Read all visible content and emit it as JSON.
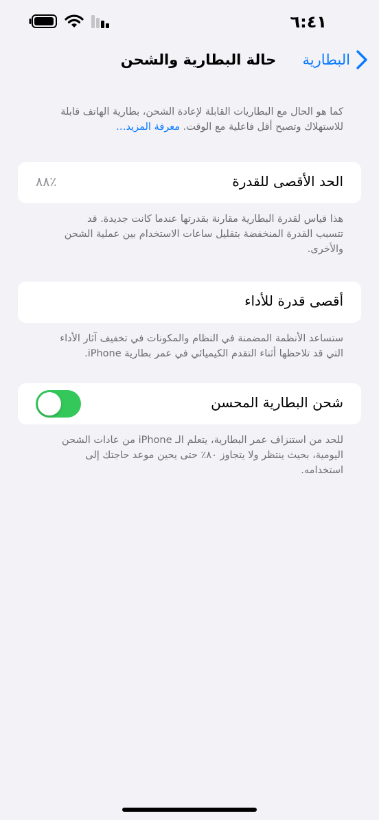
{
  "status_bar": {
    "time": "٦:٤١",
    "icons": [
      "battery-icon",
      "wifi-icon",
      "cellular-signal-icon"
    ]
  },
  "nav": {
    "back_label": "البطارية",
    "title": "حالة البطارية والشحن"
  },
  "intro": {
    "line1": "كما هو الحال مع البطاريات القابلة لإعادة الشحن، بطارية الهاتف قابلة",
    "line2": "للاستهلاك وتصبح أقل فاعلية مع الوقت.",
    "link": "معرفة المزيد…"
  },
  "max_capacity": {
    "label": "الحد الأقصى للقدرة",
    "value": "٪٨٨",
    "percent": 88,
    "desc_line1": "هذا قياس لقدرة البطارية مقارنة بقدرتها عندما كانت جديدة. قد",
    "desc_line2": "تتسبب القدرة المنخفضة بتقليل ساعات الاستخدام بين عملية الشحن",
    "desc_line3": "والأخرى."
  },
  "peak_performance": {
    "label": "أقصى قدرة للأداء",
    "desc_line1": "ستساعد الأنظمة المضمنة في النظام والمكونات في تخفيف آثار الأداء",
    "desc_line2": "التي قد تلاحظها أثناء التقدم الكيميائي في عمر بطارية iPhone."
  },
  "optimized_charging": {
    "label": "شحن البطارية المحسن",
    "enabled": true,
    "toggle_color": "#34c759",
    "desc_line1": "للحد من استنزاف عمر البطارية، يتعلم الـ iPhone من عادات الشحن",
    "desc_line2": "اليومية، بحيث ينتظر ولا يتجاوز ٨٠٪ حتى يحين موعد حاجتك إلى",
    "desc_line3": "استخدامه."
  },
  "colors": {
    "background": "#f2f2f7",
    "accent": "#0a7aff",
    "secondary_text": "#6d6d72"
  }
}
